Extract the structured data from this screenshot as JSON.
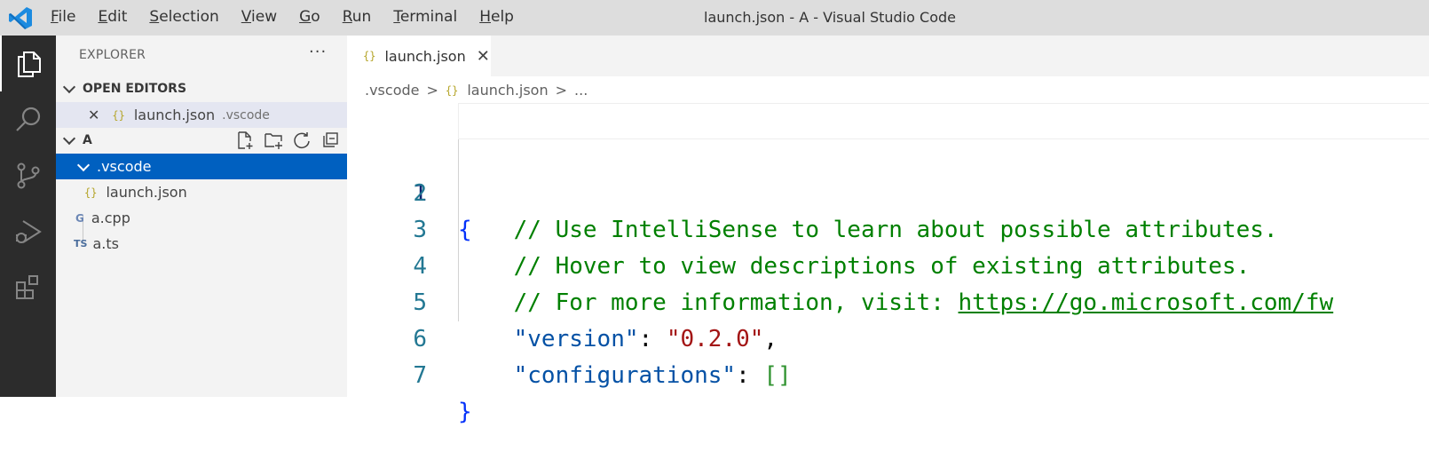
{
  "window": {
    "title": "launch.json - A - Visual Studio Code",
    "menu": [
      {
        "first": "F",
        "rest": "ile"
      },
      {
        "first": "E",
        "rest": "dit"
      },
      {
        "first": "S",
        "rest": "election"
      },
      {
        "first": "V",
        "rest": "iew"
      },
      {
        "first": "G",
        "rest": "o"
      },
      {
        "first": "R",
        "rest": "un"
      },
      {
        "first": "T",
        "rest": "erminal"
      },
      {
        "first": "H",
        "rest": "elp"
      }
    ]
  },
  "activity_bar": [
    "explorer-icon",
    "search-icon",
    "source-control-icon",
    "run-debug-icon",
    "extensions-icon"
  ],
  "sidebar": {
    "header": "EXPLORER",
    "more": "···",
    "open_editors": {
      "label": "OPEN EDITORS",
      "items": [
        {
          "close": "✕",
          "icon": "{}",
          "name": "launch.json",
          "desc": ".vscode"
        }
      ]
    },
    "folder": {
      "label": "A",
      "tree": [
        {
          "name": ".vscode",
          "type": "folder"
        },
        {
          "icon": "{}",
          "name": "launch.json"
        },
        {
          "icon": "G",
          "name": "a.cpp"
        },
        {
          "icon": "TS",
          "name": "a.ts"
        }
      ]
    }
  },
  "editor": {
    "tab": {
      "icon": "{}",
      "label": "launch.json",
      "close": "✕"
    },
    "breadcrumbs": [
      ".vscode",
      "{}",
      "launch.json",
      "..."
    ],
    "lines": [
      {
        "num": "1",
        "brace": "{"
      },
      {
        "num": "2",
        "comment": "    // Use IntelliSense to learn about possible attributes."
      },
      {
        "num": "3",
        "comment": "    // Hover to view descriptions of existing attributes."
      },
      {
        "num": "4",
        "comment": "    // For more information, visit: ",
        "link": "https://go.microsoft.com/fw"
      },
      {
        "num": "5",
        "indent": "    ",
        "key": "\"version\"",
        "colon": ": ",
        "value": "\"0.2.0\"",
        "comma": ","
      },
      {
        "num": "6",
        "indent": "    ",
        "key": "\"configurations\"",
        "colon": ": ",
        "value": "[]"
      },
      {
        "num": "7",
        "brace": "}"
      }
    ]
  },
  "colors": {
    "activity_bar": "#2c2c2c",
    "selection": "#0060c0",
    "comment": "#008000",
    "key": "#0451a5",
    "string": "#a31515"
  }
}
